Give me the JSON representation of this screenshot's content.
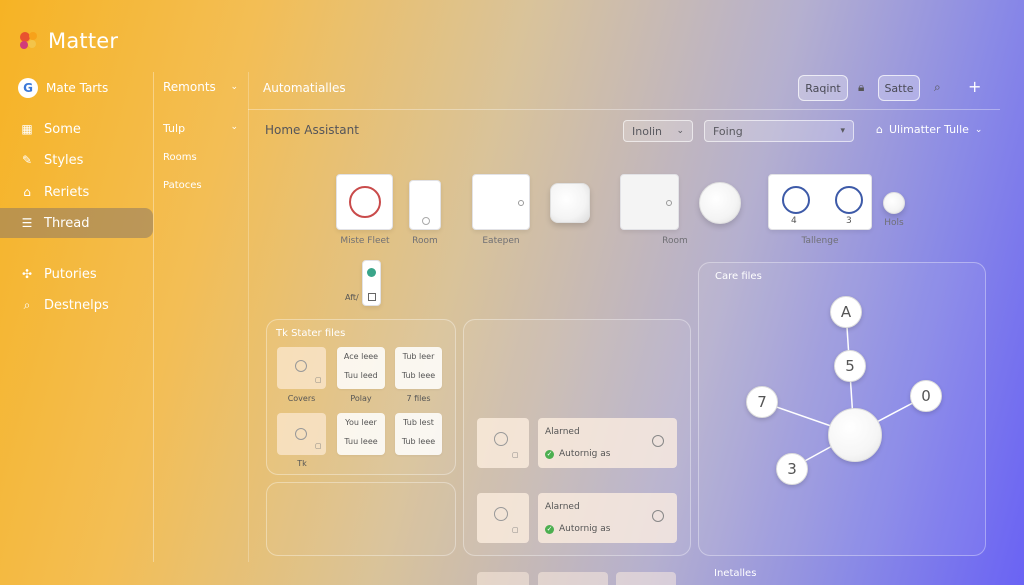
{
  "app": {
    "title": "Matter"
  },
  "sidebar": {
    "profile": "Mate Tarts",
    "items": [
      {
        "label": "Some",
        "icon": "grid-icon"
      },
      {
        "label": "Styles",
        "icon": "brush-icon"
      },
      {
        "label": "Reriets",
        "icon": "home-icon"
      },
      {
        "label": "Thread",
        "icon": "list-icon",
        "active": true
      },
      {
        "label": "Putories",
        "icon": "palette-icon"
      },
      {
        "label": "Destnelps",
        "icon": "search-icon"
      }
    ]
  },
  "subnav": {
    "header": "Remonts",
    "items": [
      "Tulp",
      "Rooms",
      "Patoces"
    ]
  },
  "topbar": {
    "title": "Automatialles",
    "buttons": {
      "primary": "Raqint",
      "secondary": "Satte"
    }
  },
  "toolbar": {
    "breadcrumb": "Home Assistant",
    "select1": "Inolin",
    "select2": "Foing",
    "user_menu": "Ulimatter Tulle"
  },
  "devices": [
    {
      "label": "Miste Fleet"
    },
    {
      "label": "Room"
    },
    {
      "label": "Eatepen"
    },
    {
      "label": "Room"
    },
    {
      "label": "Tallenge",
      "values": [
        "4",
        "3"
      ]
    },
    {
      "label": "Hols"
    }
  ],
  "device_extra": {
    "label": "Aft/"
  },
  "states": {
    "title": "Tk Stater files",
    "tiles": [
      {
        "lines": [],
        "label": "Covers"
      },
      {
        "lines": [
          "Ace leee",
          "Tuu leed"
        ],
        "label": "Polay"
      },
      {
        "lines": [
          "Tub leer",
          "Tub leee"
        ],
        "label": "7 files"
      },
      {
        "lines": [],
        "label": "Tk"
      },
      {
        "lines": [
          "You leer",
          "Tuu leee"
        ],
        "label": ""
      },
      {
        "lines": [
          "Tub lest",
          "Tub leee"
        ],
        "label": ""
      }
    ]
  },
  "alarms": [
    {
      "title": "Alarned",
      "status": "Autornig as"
    },
    {
      "title": "Alarned",
      "status": "Autornig as"
    }
  ],
  "graph": {
    "title": "Care files",
    "nodes": [
      "A",
      "5",
      "7",
      "0",
      "3"
    ]
  },
  "footer": {
    "label": "Inetalles"
  },
  "colors": {
    "accent": "#6a63f4",
    "warm": "#f6b324",
    "ok": "#4caf50"
  }
}
